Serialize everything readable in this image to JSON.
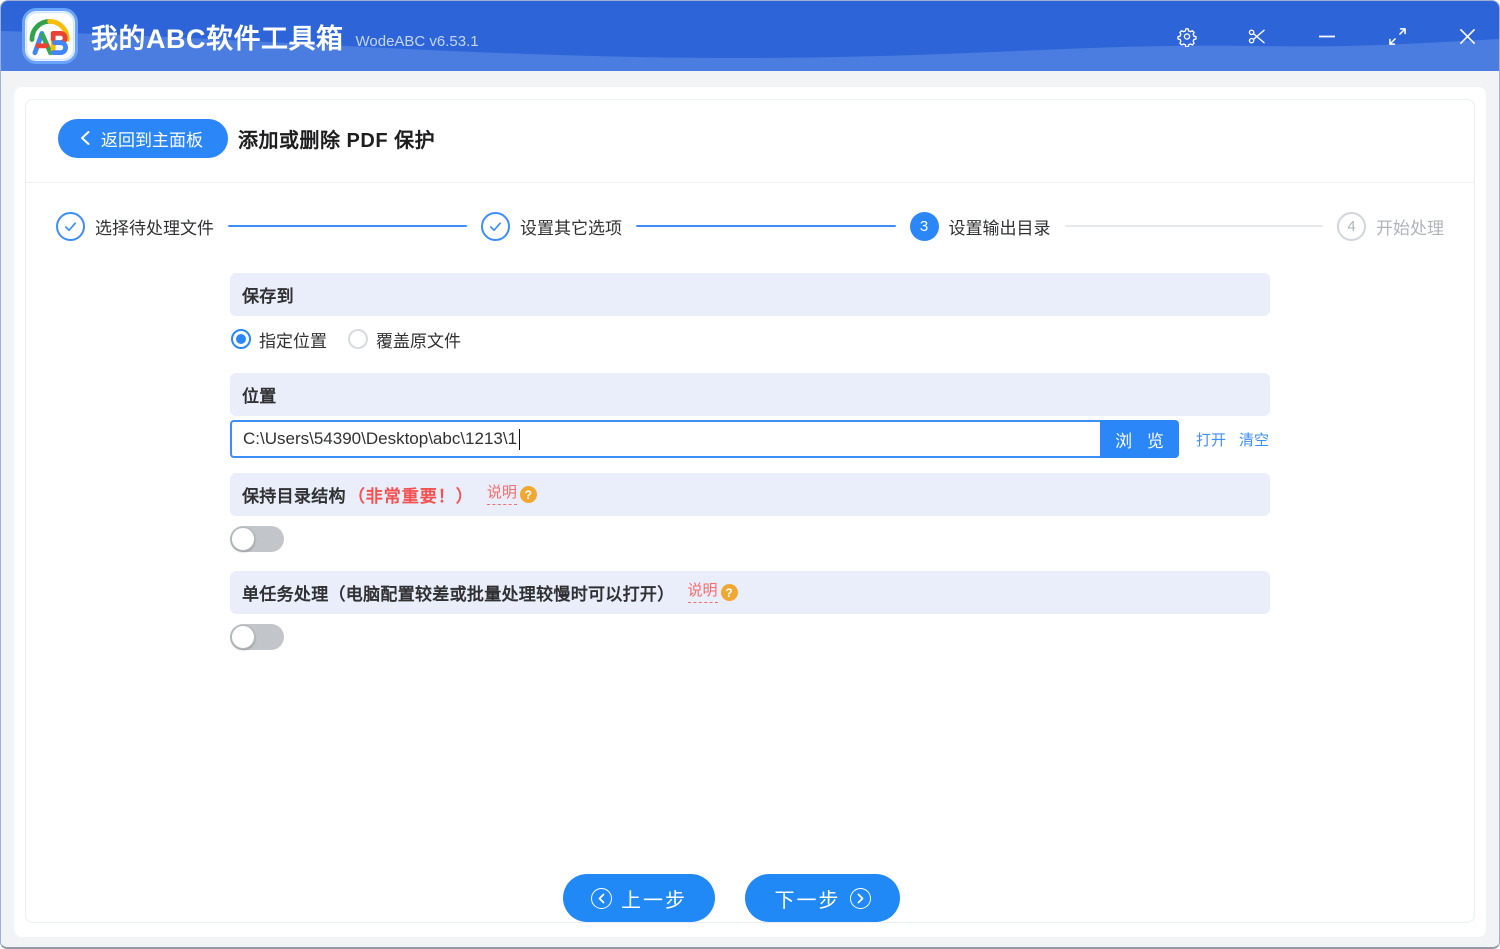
{
  "titlebar": {
    "app_title": "我的ABC软件工具箱",
    "app_version": "WodeABC v6.53.1",
    "logo_text": "AB"
  },
  "header": {
    "back_label": "返回到主面板",
    "page_title": "添加或删除 PDF 保护"
  },
  "steps": [
    {
      "label": "选择待处理文件",
      "state": "done"
    },
    {
      "label": "设置其它选项",
      "state": "done"
    },
    {
      "label": "设置输出目录",
      "state": "active",
      "number": "3"
    },
    {
      "label": "开始处理",
      "state": "todo",
      "number": "4"
    }
  ],
  "form": {
    "save_to": {
      "title": "保存到",
      "option_specified": "指定位置",
      "option_overwrite": "覆盖原文件",
      "selected": "指定位置"
    },
    "location": {
      "title": "位置",
      "path_value": "C:\\Users\\54390\\Desktop\\abc\\1213\\1",
      "browse_label": "浏 览",
      "open_label": "打开",
      "clear_label": "清空"
    },
    "keep_structure": {
      "title": "保持目录结构",
      "important_note": "（非常重要！）",
      "help_label": "说明",
      "enabled": false
    },
    "help_badge_symbol": "?",
    "single_task": {
      "title": "单任务处理（电脑配置较差或批量处理较慢时可以打开）",
      "help_label": "说明",
      "enabled": false
    }
  },
  "footer": {
    "prev_label": "上一步",
    "next_label": "下一步"
  },
  "colors": {
    "titlebar_base": "#2d65d8",
    "titlebar_wave": "#4b7ce0",
    "primary_blue": "#2b87f8",
    "step_blue": "#3e8ef7",
    "section_bar_bg": "#e9eefa",
    "danger_red": "#f45151",
    "help_red": "#f56c6c",
    "help_badge_orange": "#f0a832",
    "toggle_track_gray": "#c2c5c9",
    "text_dark": "#303133",
    "text_inactive": "#b1b4ba"
  }
}
